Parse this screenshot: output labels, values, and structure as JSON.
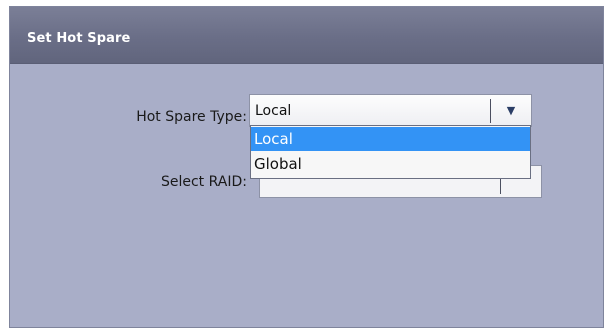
{
  "dialog": {
    "title": "Set Hot Spare"
  },
  "form": {
    "hot_spare_type_label": "Hot Spare Type:",
    "hot_spare_type_value": "Local",
    "select_raid_label": "Select RAID:"
  },
  "dropdown": {
    "options": [
      "Local",
      "Global"
    ],
    "highlighted": "Local"
  },
  "icons": {
    "dropdown_arrow": "triangle-down-icon"
  },
  "colors": {
    "titlebar": "#6a6e87",
    "panel": "#a9aec8",
    "highlight": "#3393f5"
  }
}
